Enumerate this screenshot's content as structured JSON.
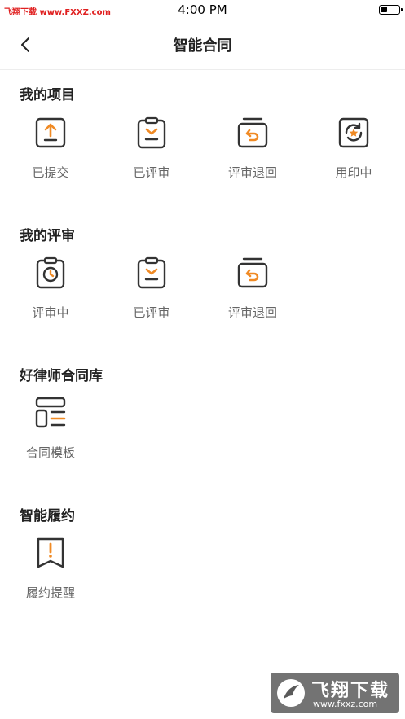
{
  "status_bar": {
    "watermark": "飞翔下载 www.FXXZ.com",
    "time": "4:00 PM"
  },
  "nav": {
    "title": "智能合同"
  },
  "colors": {
    "accent": "#f08a24",
    "icon_dark": "#333333",
    "label": "#666666"
  },
  "sections": [
    {
      "title": "我的项目",
      "items": [
        {
          "label": "已提交",
          "icon": "upload-clipboard-icon"
        },
        {
          "label": "已评审",
          "icon": "checked-clipboard-icon"
        },
        {
          "label": "评审退回",
          "icon": "return-tray-icon"
        },
        {
          "label": "用印中",
          "icon": "stamp-refresh-icon"
        }
      ]
    },
    {
      "title": "我的评审",
      "items": [
        {
          "label": "评审中",
          "icon": "clock-clipboard-icon"
        },
        {
          "label": "已评审",
          "icon": "checked-clipboard-icon"
        },
        {
          "label": "评审退回",
          "icon": "return-tray-icon"
        }
      ]
    },
    {
      "title": "好律师合同库",
      "items": [
        {
          "label": "合同模板",
          "icon": "template-layout-icon"
        }
      ]
    },
    {
      "title": "智能履约",
      "items": [
        {
          "label": "履约提醒",
          "icon": "reminder-bookmark-icon"
        }
      ]
    }
  ],
  "watermark_bottom": {
    "big": "飞翔下载",
    "small": "www.fxxz.com"
  }
}
